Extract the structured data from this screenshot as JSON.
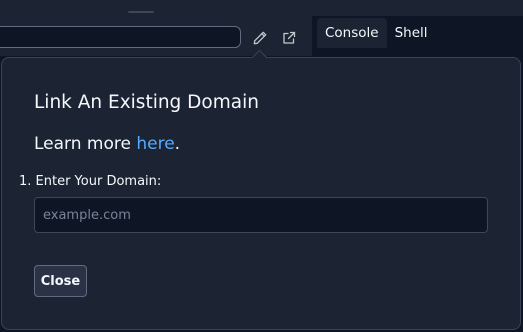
{
  "console_pane": {
    "tabs": [
      {
        "label": "Console",
        "active": true
      },
      {
        "label": "Shell",
        "active": false
      }
    ]
  },
  "url_bar": {
    "edit_icon": "pencil-icon",
    "open_icon": "external-link-icon"
  },
  "popover": {
    "title": "Link An Existing Domain",
    "learn_more_prefix": "Learn more ",
    "learn_more_link": "here",
    "learn_more_suffix": ".",
    "step_label": "1. Enter Your Domain:",
    "domain_placeholder": "example.com",
    "domain_value": "",
    "close_label": "Close"
  },
  "colors": {
    "background": "#0e1525",
    "surface": "#1c2333",
    "border": "#3c445c",
    "link": "#57abff",
    "text": "#f5f9fc"
  }
}
